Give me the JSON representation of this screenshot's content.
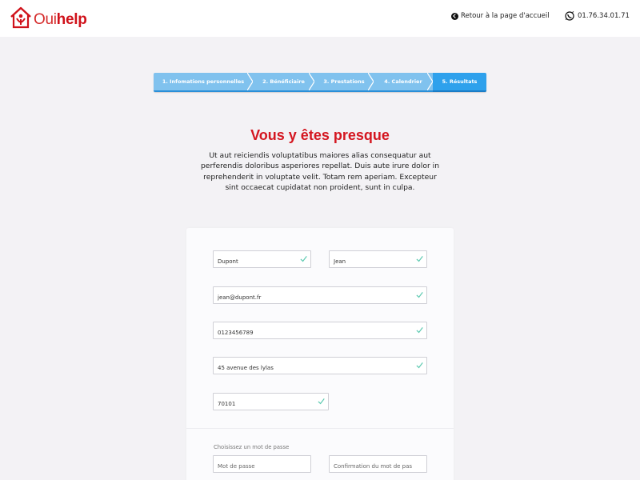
{
  "header": {
    "logo": {
      "oui": "Oui",
      "help": "help"
    },
    "back_link": "Retour à la page d'accueil",
    "phone": "01.76.34.01.71"
  },
  "stepper": {
    "steps": [
      {
        "label": "1. Infomations personnelles",
        "active": false
      },
      {
        "label": "2. Bénéficiaire",
        "active": false
      },
      {
        "label": "3. Prestations",
        "active": false
      },
      {
        "label": "4. Calendrier",
        "active": false
      },
      {
        "label": "5. Résultats",
        "active": true
      }
    ]
  },
  "main": {
    "title": "Vous y êtes presque",
    "intro": "Ut aut reiciendis voluptatibus maiores alias consequatur aut perferendis doloribus asperiores repellat. Duis aute irure dolor in reprehenderit in voluptate velit. Totam rem aperiam. Excepteur sint occaecat cupidatat non proident, sunt in culpa."
  },
  "form": {
    "last_name": "Dupont",
    "first_name": "Jean",
    "email": "jean@dupont.fr",
    "phone": "0123456789",
    "address": "45 avenue des lylas",
    "postal_code": "70101",
    "password_label": "Choisissez un mot de passe",
    "password_placeholder": "Mot de passe",
    "password_confirm_placeholder": "Confirmation du mot de passe"
  },
  "colors": {
    "brand_red": "#d41620",
    "step_inactive": "#80c2ee",
    "step_active": "#2ea1ec",
    "check_green": "#5cc9b0"
  }
}
